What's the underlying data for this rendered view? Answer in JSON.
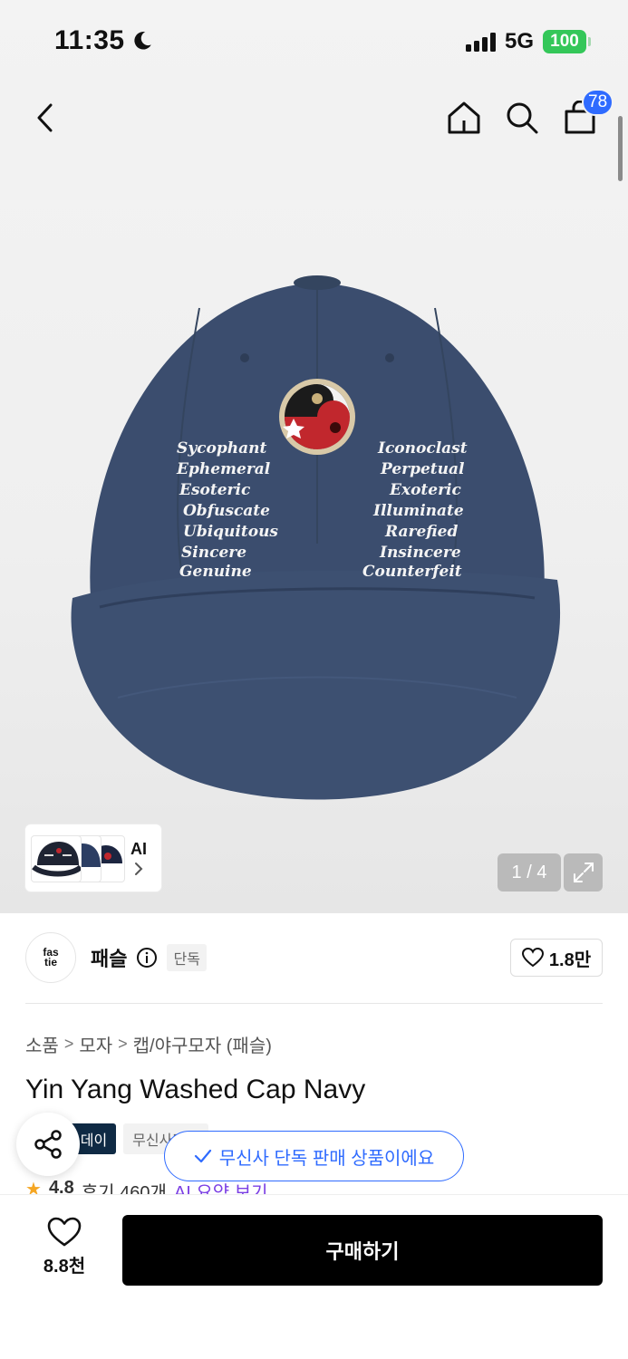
{
  "status_bar": {
    "time": "11:35",
    "network": "5G",
    "battery": "100"
  },
  "nav": {
    "cart_count": "78"
  },
  "gallery": {
    "ai_label": "AI",
    "page_indicator": "1 / 4",
    "cap_left_words": [
      "Sycophant",
      "Ephemeral",
      "Esoteric",
      "Obfuscate",
      "Ubiquitous",
      "Sincere",
      "Genuine"
    ],
    "cap_right_words": [
      "Iconoclast",
      "Perpetual",
      "Exoteric",
      "Illuminate",
      "Rarefied",
      "Insincere",
      "Counterfeit"
    ],
    "logo_text_top": "fas",
    "logo_text_bottom": "tie"
  },
  "brand": {
    "name": "패슬",
    "exclusive_badge": "단독",
    "likes": "1.8만"
  },
  "breadcrumb": [
    "소품",
    "모자",
    "캡/야구모자 (패슬)"
  ],
  "product": {
    "title": "Yin Yang Washed Cap Navy",
    "tags": [
      "스데이",
      "무신사단독"
    ]
  },
  "toast": {
    "text": "무신사 단독 판매 상품이에요"
  },
  "rating": {
    "score": "4.8",
    "reviews": "후기 460개",
    "ai_summary": "AI 요약 보기"
  },
  "bottom": {
    "wish_count": "8.8천",
    "buy_label": "구매하기"
  },
  "colors": {
    "accent": "#2f6bff",
    "battery": "#34c759",
    "cap_navy": "#3b4d6e",
    "tag_dark": "#0f2a44"
  }
}
